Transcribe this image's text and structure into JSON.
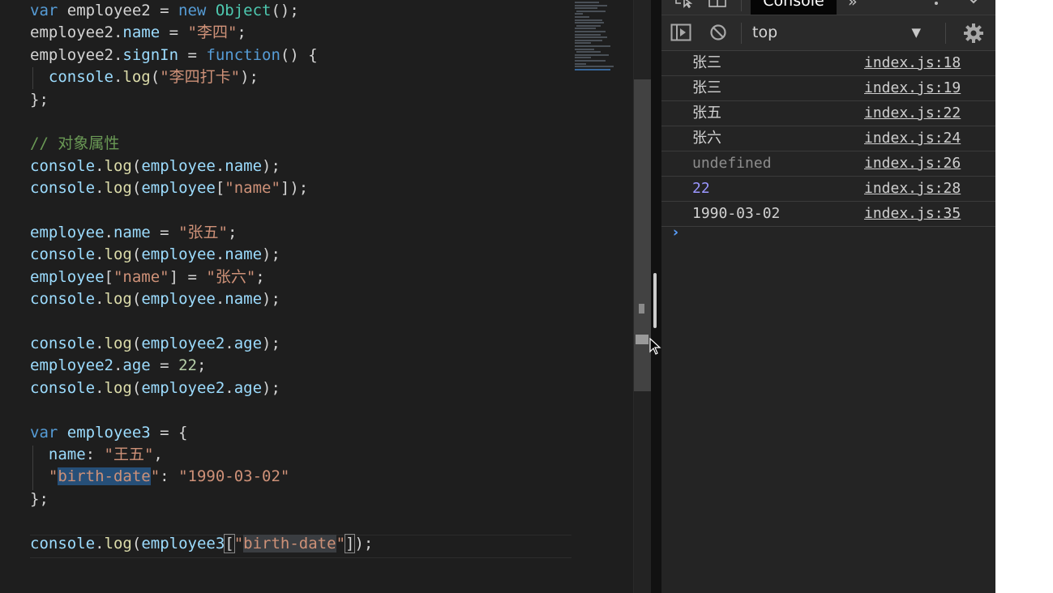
{
  "editor": {
    "lines": [
      {
        "tokens": [
          {
            "t": "var ",
            "c": "kw"
          },
          {
            "t": "employee2 = ",
            "c": "pun"
          },
          {
            "t": "new ",
            "c": "kw"
          },
          {
            "t": "Object",
            "c": "cls"
          },
          {
            "t": "();",
            "c": "pun"
          }
        ]
      },
      {
        "tokens": [
          {
            "t": "employee2",
            "c": "pun"
          },
          {
            "t": ".",
            "c": "pun"
          },
          {
            "t": "name",
            "c": "prop"
          },
          {
            "t": " = ",
            "c": "pun"
          },
          {
            "t": "\"李四\"",
            "c": "str"
          },
          {
            "t": ";",
            "c": "pun"
          }
        ]
      },
      {
        "tokens": [
          {
            "t": "employee2",
            "c": "pun"
          },
          {
            "t": ".",
            "c": "pun"
          },
          {
            "t": "signIn",
            "c": "prop"
          },
          {
            "t": " = ",
            "c": "pun"
          },
          {
            "t": "function",
            "c": "kw"
          },
          {
            "t": "() {",
            "c": "pun"
          }
        ]
      },
      {
        "tokens": [
          {
            "t": "  console",
            "c": "prop"
          },
          {
            "t": ".",
            "c": "pun"
          },
          {
            "t": "log",
            "c": "fn"
          },
          {
            "t": "(",
            "c": "pun"
          },
          {
            "t": "\"李四打卡\"",
            "c": "str"
          },
          {
            "t": ");",
            "c": "pun"
          }
        ]
      },
      {
        "tokens": [
          {
            "t": "};",
            "c": "pun"
          }
        ]
      },
      {
        "tokens": []
      },
      {
        "tokens": [
          {
            "t": "// 对象属性",
            "c": "cmt"
          }
        ]
      },
      {
        "tokens": [
          {
            "t": "console",
            "c": "prop"
          },
          {
            "t": ".",
            "c": "pun"
          },
          {
            "t": "log",
            "c": "fn"
          },
          {
            "t": "(",
            "c": "pun"
          },
          {
            "t": "employee",
            "c": "prop"
          },
          {
            "t": ".",
            "c": "pun"
          },
          {
            "t": "name",
            "c": "prop"
          },
          {
            "t": ");",
            "c": "pun"
          }
        ]
      },
      {
        "tokens": [
          {
            "t": "console",
            "c": "prop"
          },
          {
            "t": ".",
            "c": "pun"
          },
          {
            "t": "log",
            "c": "fn"
          },
          {
            "t": "(",
            "c": "pun"
          },
          {
            "t": "employee",
            "c": "prop"
          },
          {
            "t": "[",
            "c": "pun"
          },
          {
            "t": "\"name\"",
            "c": "str"
          },
          {
            "t": "]);",
            "c": "pun"
          }
        ]
      },
      {
        "tokens": []
      },
      {
        "tokens": [
          {
            "t": "employee",
            "c": "prop"
          },
          {
            "t": ".",
            "c": "pun"
          },
          {
            "t": "name",
            "c": "prop"
          },
          {
            "t": " = ",
            "c": "pun"
          },
          {
            "t": "\"张五\"",
            "c": "str"
          },
          {
            "t": ";",
            "c": "pun"
          }
        ]
      },
      {
        "tokens": [
          {
            "t": "console",
            "c": "prop"
          },
          {
            "t": ".",
            "c": "pun"
          },
          {
            "t": "log",
            "c": "fn"
          },
          {
            "t": "(",
            "c": "pun"
          },
          {
            "t": "employee",
            "c": "prop"
          },
          {
            "t": ".",
            "c": "pun"
          },
          {
            "t": "name",
            "c": "prop"
          },
          {
            "t": ");",
            "c": "pun"
          }
        ]
      },
      {
        "tokens": [
          {
            "t": "employee",
            "c": "prop"
          },
          {
            "t": "[",
            "c": "pun"
          },
          {
            "t": "\"name\"",
            "c": "str"
          },
          {
            "t": "] = ",
            "c": "pun"
          },
          {
            "t": "\"张六\"",
            "c": "str"
          },
          {
            "t": ";",
            "c": "pun"
          }
        ]
      },
      {
        "tokens": [
          {
            "t": "console",
            "c": "prop"
          },
          {
            "t": ".",
            "c": "pun"
          },
          {
            "t": "log",
            "c": "fn"
          },
          {
            "t": "(",
            "c": "pun"
          },
          {
            "t": "employee",
            "c": "prop"
          },
          {
            "t": ".",
            "c": "pun"
          },
          {
            "t": "name",
            "c": "prop"
          },
          {
            "t": ");",
            "c": "pun"
          }
        ]
      },
      {
        "tokens": []
      },
      {
        "tokens": [
          {
            "t": "console",
            "c": "prop"
          },
          {
            "t": ".",
            "c": "pun"
          },
          {
            "t": "log",
            "c": "fn"
          },
          {
            "t": "(",
            "c": "pun"
          },
          {
            "t": "employee2",
            "c": "prop"
          },
          {
            "t": ".",
            "c": "pun"
          },
          {
            "t": "age",
            "c": "prop"
          },
          {
            "t": ");",
            "c": "pun"
          }
        ]
      },
      {
        "tokens": [
          {
            "t": "employee2",
            "c": "prop"
          },
          {
            "t": ".",
            "c": "pun"
          },
          {
            "t": "age",
            "c": "prop"
          },
          {
            "t": " = ",
            "c": "pun"
          },
          {
            "t": "22",
            "c": "num"
          },
          {
            "t": ";",
            "c": "pun"
          }
        ]
      },
      {
        "tokens": [
          {
            "t": "console",
            "c": "prop"
          },
          {
            "t": ".",
            "c": "pun"
          },
          {
            "t": "log",
            "c": "fn"
          },
          {
            "t": "(",
            "c": "pun"
          },
          {
            "t": "employee2",
            "c": "prop"
          },
          {
            "t": ".",
            "c": "pun"
          },
          {
            "t": "age",
            "c": "prop"
          },
          {
            "t": ");",
            "c": "pun"
          }
        ]
      },
      {
        "tokens": []
      },
      {
        "tokens": [
          {
            "t": "var ",
            "c": "kw"
          },
          {
            "t": "employee3",
            "c": "prop"
          },
          {
            "t": " = {",
            "c": "pun"
          }
        ]
      },
      {
        "tokens": [
          {
            "t": "  name",
            "c": "prop"
          },
          {
            "t": ": ",
            "c": "pun"
          },
          {
            "t": "\"王五\"",
            "c": "str"
          },
          {
            "t": ",",
            "c": "pun"
          }
        ]
      },
      {
        "tokens": [
          {
            "t": "  \"",
            "c": "str"
          },
          {
            "t": "birth-date",
            "c": "str sel"
          },
          {
            "t": "\"",
            "c": "str"
          },
          {
            "t": ": ",
            "c": "pun"
          },
          {
            "t": "\"1990-03-02\"",
            "c": "str"
          }
        ]
      },
      {
        "tokens": [
          {
            "t": "};",
            "c": "pun"
          }
        ]
      },
      {
        "tokens": []
      },
      {
        "tokens": [
          {
            "t": "console",
            "c": "prop"
          },
          {
            "t": ".",
            "c": "pun"
          },
          {
            "t": "log",
            "c": "fn"
          },
          {
            "t": "(",
            "c": "pun"
          },
          {
            "t": "employee3",
            "c": "prop"
          },
          {
            "t": "[",
            "c": "pun brk"
          },
          {
            "t": "\"",
            "c": "str"
          },
          {
            "t": "birth-date",
            "c": "str match"
          },
          {
            "t": "\"",
            "c": "str"
          },
          {
            "t": "]",
            "c": "pun brk"
          },
          {
            "t": ");",
            "c": "pun"
          }
        ]
      }
    ]
  },
  "devtools": {
    "active_tab": "Console",
    "more_tabs": "»",
    "context": "top",
    "context_arrow": "▼",
    "messages": [
      {
        "text": "张三",
        "source": "index.js:18",
        "kind": "string"
      },
      {
        "text": "张三",
        "source": "index.js:19",
        "kind": "string"
      },
      {
        "text": "张五",
        "source": "index.js:22",
        "kind": "string"
      },
      {
        "text": "张六",
        "source": "index.js:24",
        "kind": "string"
      },
      {
        "text": "undefined",
        "source": "index.js:26",
        "kind": "undefined"
      },
      {
        "text": "22",
        "source": "index.js:28",
        "kind": "number"
      },
      {
        "text": "1990-03-02",
        "source": "index.js:35",
        "kind": "string"
      }
    ],
    "prompt": "›"
  }
}
